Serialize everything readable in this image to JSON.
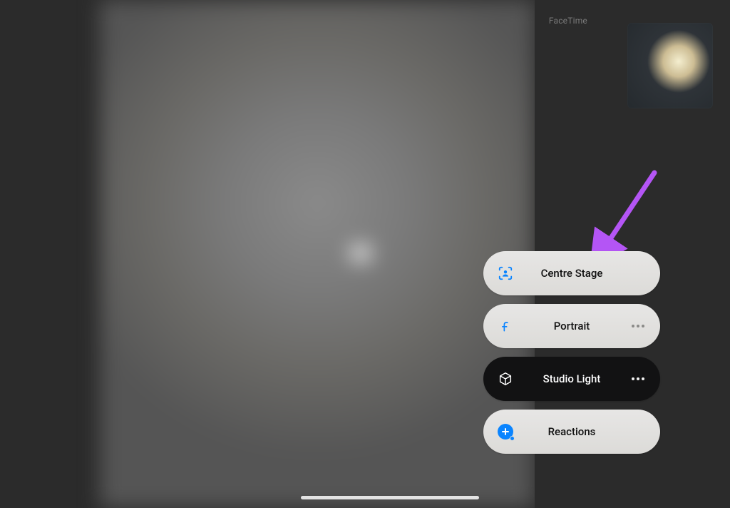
{
  "app_label": "FaceTime",
  "options": {
    "centre_stage": {
      "label": "Centre Stage"
    },
    "portrait": {
      "label": "Portrait"
    },
    "studio_light": {
      "label": "Studio Light"
    },
    "reactions": {
      "label": "Reactions"
    }
  },
  "annotation": {
    "arrow_color": "#b455f5"
  }
}
